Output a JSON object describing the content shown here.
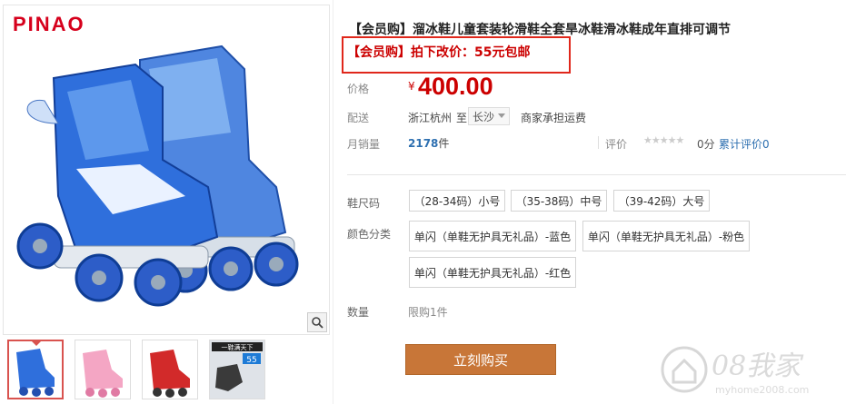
{
  "brand": {
    "logo_text": "PINAO"
  },
  "product": {
    "title": "【会员购】溜冰鞋儿童套装轮滑鞋全套旱冰鞋滑冰鞋成年直排可调节",
    "promo": "【会员购】拍下改价：55元包邮",
    "price_label": "价格",
    "currency": "¥",
    "price": "400.00",
    "ship_label": "配送",
    "ship_from": "浙江杭州",
    "ship_to_word": "至",
    "ship_city": "长沙",
    "ship_fee": "商家承担运费",
    "sales_label": "月销量",
    "sales_count": "2178",
    "sales_unit": "件",
    "rating_label": "评价",
    "rating_stars": "★★★★★",
    "rating_score": "0分",
    "rating_link": "累计评价0",
    "size_label": "鞋尺码",
    "sizes": [
      "（28-34码）小号",
      "（35-38码）中号",
      "（39-42码）大号"
    ],
    "color_label": "颜色分类",
    "colors": [
      "单闪（单鞋无护具无礼品）-蓝色",
      "单闪（单鞋无护具无礼品）-粉色",
      "单闪（单鞋无护具无礼品）-红色"
    ],
    "qty_label": "数量",
    "qty_limit": "限购1件",
    "buy_button": "立刻购买"
  },
  "thumbnails": [
    "blue skates",
    "pink skates",
    "red skates",
    "一鞋满天下 55"
  ],
  "thumbnail_texts": {
    "t4_top": "一鞋满天下",
    "t4_num": "55"
  },
  "watermark": {
    "text": "08我家",
    "url": "myhome2008.com"
  },
  "colors": {
    "accent_red": "#c00000",
    "buy_button": "#c87638",
    "link_blue": "#2d6fb0",
    "skate_blue": "#2a5fcf"
  }
}
